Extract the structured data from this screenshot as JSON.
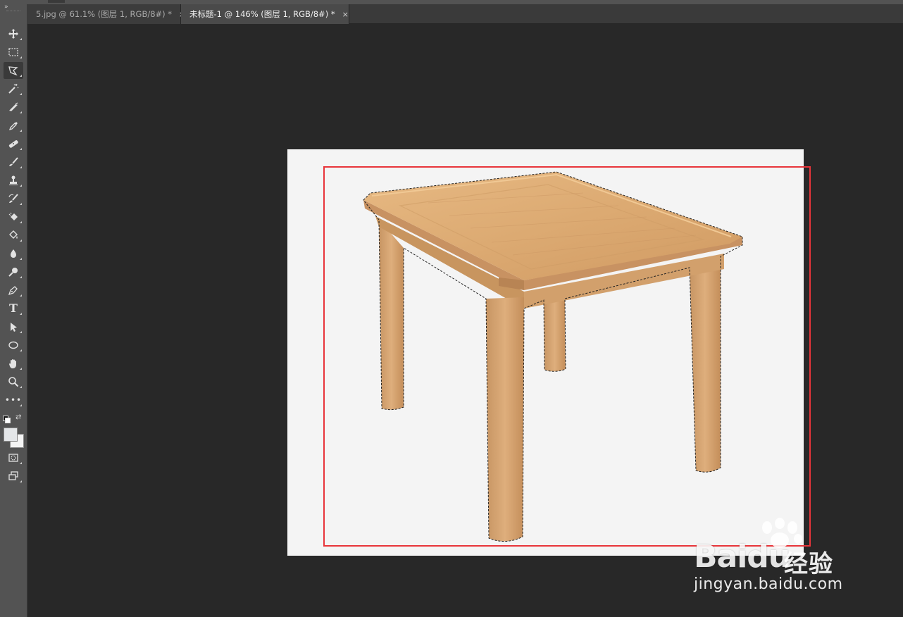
{
  "colors": {
    "workspace_bg": "#282828",
    "toolbar_bg": "#535353",
    "tabbar_bg": "#3a3a3a",
    "active_tab_bg": "#4a4a4a",
    "canvas_bg": "#f4f4f4",
    "highlight_box": "#e8353a",
    "wood": "#d9a66e"
  },
  "tabs": [
    {
      "label": "5.jpg @ 61.1% (图层 1, RGB/8#) *",
      "close": "×",
      "active": false
    },
    {
      "label": "未标题-1 @ 146% (图层 1, RGB/8#) *",
      "close": "×",
      "active": true
    }
  ],
  "toolbar": {
    "collapse_glyph": "»",
    "tools": [
      {
        "name": "move-tool",
        "icon": "move-icon"
      },
      {
        "name": "rectangular-marquee-tool",
        "icon": "marquee-icon"
      },
      {
        "name": "polygonal-lasso-tool",
        "icon": "lasso-icon",
        "active": true
      },
      {
        "name": "magic-wand-tool",
        "icon": "magic-wand-icon"
      },
      {
        "name": "crop-tool",
        "icon": "crop-icon"
      },
      {
        "name": "eyedropper-tool",
        "icon": "eyedropper-icon"
      },
      {
        "name": "healing-brush-tool",
        "icon": "bandage-icon"
      },
      {
        "name": "brush-tool",
        "icon": "brush-icon"
      },
      {
        "name": "clone-stamp-tool",
        "icon": "stamp-icon"
      },
      {
        "name": "history-brush-tool",
        "icon": "history-brush-icon"
      },
      {
        "name": "eraser-tool",
        "icon": "eraser-icon"
      },
      {
        "name": "paint-bucket-tool",
        "icon": "paint-bucket-icon"
      },
      {
        "name": "blur-tool",
        "icon": "drop-icon"
      },
      {
        "name": "dodge-tool",
        "icon": "dodge-icon"
      },
      {
        "name": "pen-tool",
        "icon": "pen-icon"
      },
      {
        "name": "type-tool",
        "icon": "type-icon",
        "glyph": "T"
      },
      {
        "name": "path-selection-tool",
        "icon": "arrow-icon"
      },
      {
        "name": "ellipse-tool",
        "icon": "ellipse-icon"
      },
      {
        "name": "hand-tool",
        "icon": "hand-icon"
      },
      {
        "name": "zoom-tool",
        "icon": "zoom-icon"
      },
      {
        "name": "edit-toolbar",
        "icon": "more-icon",
        "glyph": "•••"
      }
    ],
    "swap_glyph": "⇄"
  },
  "watermark": {
    "brand": "Baidu",
    "product": "经验",
    "url": "jingyan.baidu.com"
  }
}
